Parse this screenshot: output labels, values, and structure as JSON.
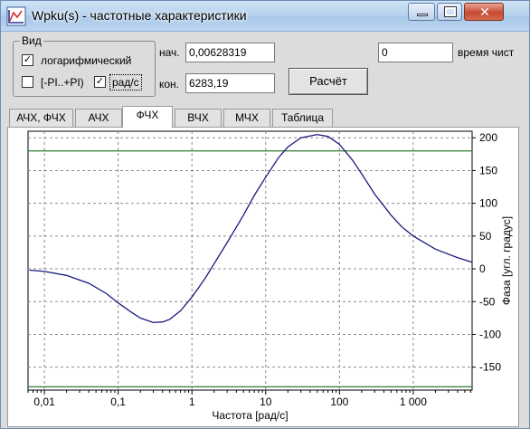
{
  "window": {
    "title": "Wpku(s) - частотные характеристики",
    "close_glyph": "✕"
  },
  "view_group": {
    "title": "Вид",
    "log_label": "логарифмический",
    "log_checked": true,
    "pi_label": "[-PI..+PI)",
    "pi_checked": false,
    "rad_label": "рад/с",
    "rad_checked": true
  },
  "range": {
    "start_label": "нач.",
    "start_value": "0,00628319",
    "end_label": "кон.",
    "end_value": "6283,19"
  },
  "time_value": "0",
  "time_label": "время чист",
  "calc_button": "Расчёт",
  "tabs": [
    "АЧХ, ФЧХ",
    "АЧХ",
    "ФЧХ",
    "ВЧХ",
    "МЧХ",
    "Таблица"
  ],
  "active_tab": "ФЧХ",
  "chart_data": {
    "type": "line",
    "xlabel": "Частота [рад/с]",
    "ylabel": "Фаза [угл. градус]",
    "x_scale": "log",
    "xlim": [
      0.006,
      6283.19
    ],
    "ylim": [
      -185,
      210
    ],
    "x_tick_values": [
      0.01,
      0.1,
      1,
      10,
      100,
      1000
    ],
    "x_tick_labels": [
      "0,01",
      "0,1",
      "1",
      "10",
      "100",
      "1 000"
    ],
    "y_ticks": [
      200,
      150,
      100,
      50,
      0,
      -50,
      -100,
      -150
    ],
    "grid": true,
    "reference_lines": [
      180,
      -180
    ],
    "series": [
      {
        "color": "#1a1a80",
        "x": [
          0.00628,
          0.01,
          0.02,
          0.04,
          0.07,
          0.1,
          0.15,
          0.2,
          0.3,
          0.4,
          0.5,
          0.7,
          1,
          1.5,
          2,
          3,
          5,
          7,
          10,
          15,
          20,
          30,
          50,
          70,
          100,
          150,
          200,
          300,
          500,
          700,
          1000,
          2000,
          4000,
          6283.19
        ],
        "y": [
          -2,
          -4,
          -10,
          -22,
          -38,
          -52,
          -66,
          -75,
          -82,
          -81,
          -77,
          -64,
          -43,
          -15,
          8,
          40,
          82,
          112,
          140,
          170,
          186,
          200,
          205,
          202,
          190,
          166,
          145,
          114,
          82,
          64,
          50,
          30,
          17,
          10
        ]
      }
    ]
  }
}
